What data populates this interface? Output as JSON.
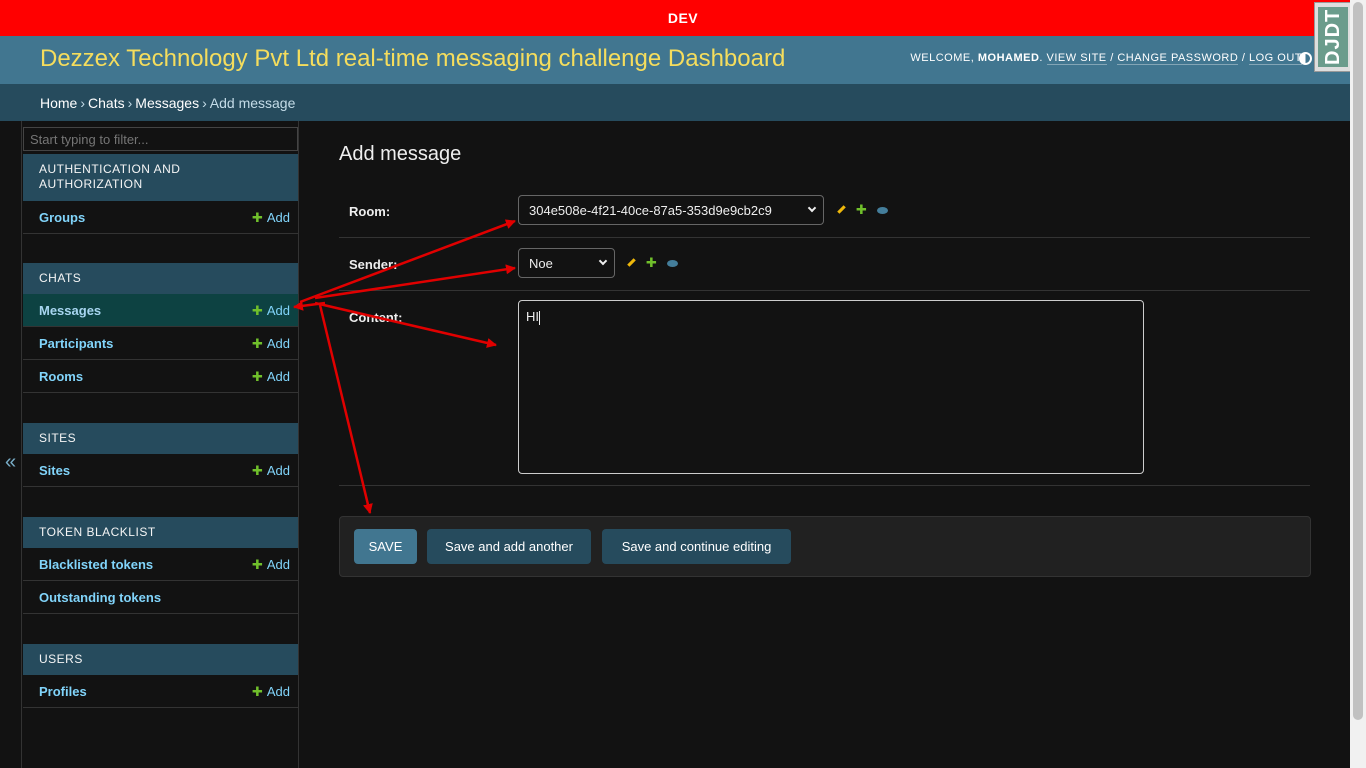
{
  "env_label": "DEV",
  "header": {
    "title": "Dezzex Technology Pvt Ltd real-time messaging challenge Dashboard",
    "welcome": "Welcome,",
    "username": "Mohamed",
    "view_site": "View site",
    "change_password": "Change password",
    "log_out": "Log out"
  },
  "breadcrumbs": [
    "Home",
    "Chats",
    "Messages",
    "Add message"
  ],
  "debug_toolbar_label": "DJDT",
  "sidebar": {
    "filter_placeholder": "Start typing to filter...",
    "collapse_icon": "«",
    "add_label": "Add",
    "modules": [
      {
        "caption": "Authentication and Authorization",
        "models": [
          {
            "name": "Groups"
          }
        ]
      },
      {
        "caption": "Chats",
        "models": [
          {
            "name": "Messages"
          },
          {
            "name": "Participants"
          },
          {
            "name": "Rooms"
          }
        ]
      },
      {
        "caption": "Sites",
        "models": [
          {
            "name": "Sites"
          }
        ]
      },
      {
        "caption": "Token Blacklist",
        "models": [
          {
            "name": "Blacklisted tokens"
          },
          {
            "name": "Outstanding tokens"
          }
        ]
      },
      {
        "caption": "Users",
        "models": [
          {
            "name": "Profiles"
          }
        ]
      }
    ]
  },
  "form": {
    "title": "Add message",
    "room_label": "Room:",
    "room_value": "304e508e-4f21-40ce-87a5-353d9e9cb2c9",
    "sender_label": "Sender:",
    "sender_value": "Noe",
    "content_label": "Content:",
    "content_value": "HI"
  },
  "submit": {
    "save": "Save",
    "save_add_another": "Save and add another",
    "save_continue": "Save and continue editing"
  },
  "colors": {
    "env_bar": "#ff0000",
    "header": "#417690",
    "branding": "#f5dd5d",
    "breadcrumbs": "#264b5d",
    "annotation_arrows": "#e00000"
  }
}
